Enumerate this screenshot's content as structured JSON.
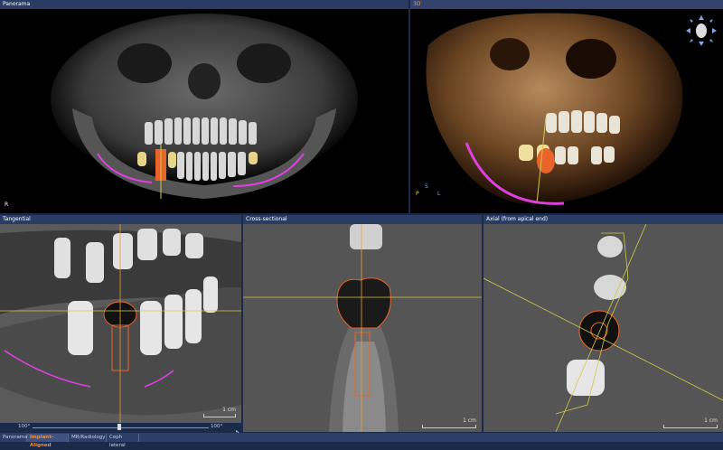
{
  "panels": {
    "panorama": {
      "title": "Panorama",
      "orientation": "R"
    },
    "view3d": {
      "title": "3D",
      "orient_s": "S",
      "orient_p": "P",
      "orient_l": "L"
    },
    "tangential": {
      "title": "Tangential",
      "scale": "1 cm"
    },
    "cross": {
      "title": "Cross-sectional",
      "scale": "1 cm"
    },
    "axial": {
      "title": "Axial (from apical end)",
      "scale": "1 cm"
    }
  },
  "slider": {
    "min_label": "100°",
    "max_label": "100°"
  },
  "tabs": [
    {
      "label": "Panorama"
    },
    {
      "label": "Implant-Aligned"
    },
    {
      "label": "MR/Radiology"
    },
    {
      "label": "Ceph lateral"
    }
  ],
  "colors": {
    "accent": "#ff8a2a",
    "nerve": "#e040e0",
    "guide": "#d4c84a",
    "implant": "#e8642a"
  }
}
